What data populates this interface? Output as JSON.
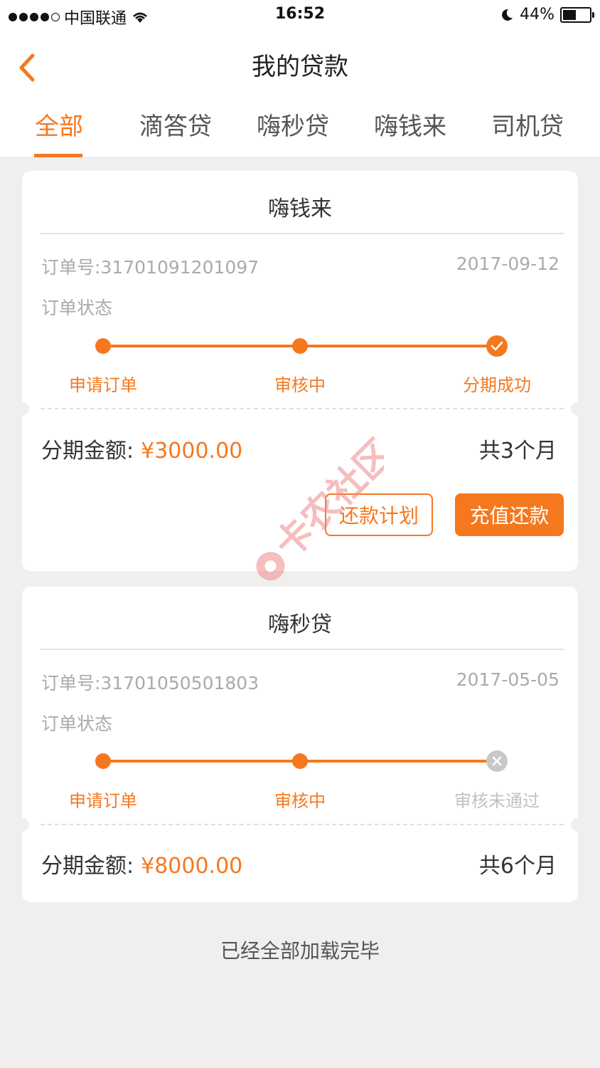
{
  "status_bar": {
    "carrier": "中国联通",
    "time": "16:52",
    "battery": "44%",
    "battery_level": 0.44
  },
  "header": {
    "title": "我的贷款",
    "back_icon": "chevron-left-icon"
  },
  "tabs": [
    {
      "label": "全部",
      "active": true
    },
    {
      "label": "滴答贷",
      "active": false
    },
    {
      "label": "嗨秒贷",
      "active": false
    },
    {
      "label": "嗨钱来",
      "active": false
    },
    {
      "label": "司机贷",
      "active": false
    }
  ],
  "loans": [
    {
      "product": "嗨钱来",
      "order_no": "订单号:31701091201097",
      "date": "2017-09-12",
      "status_label": "订单状态",
      "steps": [
        "申请订单",
        "审核中",
        "分期成功"
      ],
      "final_state": "success",
      "amount_label": "分期金额:",
      "amount": "¥3000.00",
      "months": "共3个月",
      "buttons": {
        "plan": "还款计划",
        "pay": "充值还款"
      }
    },
    {
      "product": "嗨秒贷",
      "order_no": "订单号:31701050501803",
      "date": "2017-05-05",
      "status_label": "订单状态",
      "steps": [
        "申请订单",
        "审核中",
        "审核未通过"
      ],
      "final_state": "rejected",
      "amount_label": "分期金额:",
      "amount": "¥8000.00",
      "months": "共6个月"
    }
  ],
  "footer": "已经全部加载完毕",
  "watermark_text": "卡农社区",
  "colors": {
    "accent": "#f5781f",
    "background": "#efefef",
    "muted": "#aaaaaa",
    "rejected": "#c8c8c8"
  }
}
